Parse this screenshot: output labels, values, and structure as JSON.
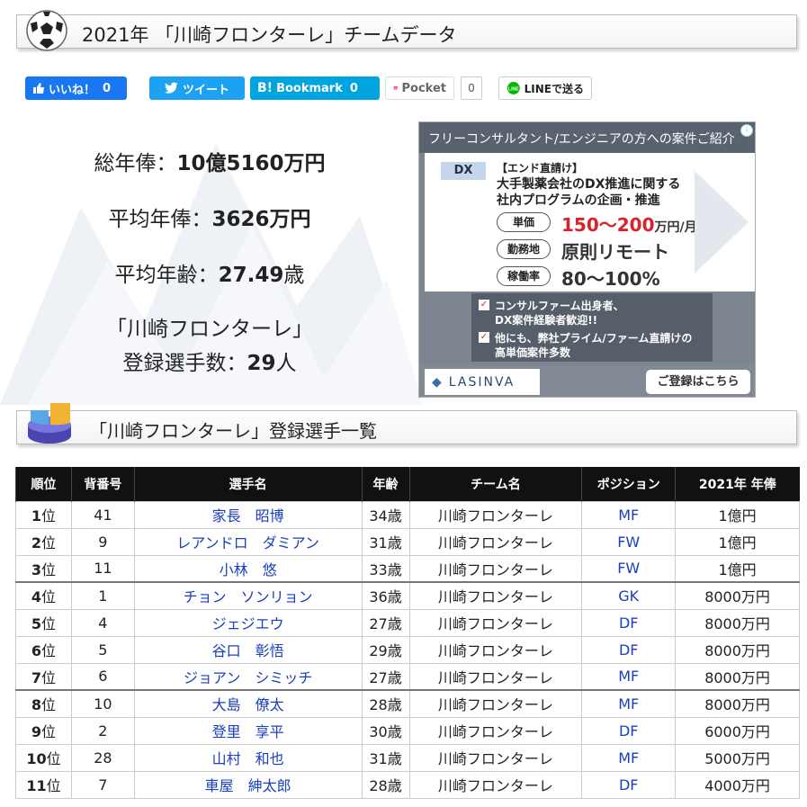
{
  "header": {
    "title": "2021年 「川崎フロンターレ」チームデータ"
  },
  "share": {
    "facebook": {
      "label": "いいね！",
      "count": "0"
    },
    "twitter": {
      "label": "ツイート"
    },
    "hatena": {
      "label": "Bookmark",
      "count": "0"
    },
    "pocket": {
      "label": "Pocket",
      "count": "0"
    },
    "line": {
      "label": "LINEで送る"
    }
  },
  "summary": {
    "total_label": "総年俸：",
    "total_value": "10億5160万円",
    "avg_salary_label": "平均年俸：",
    "avg_salary_value": "3626万円",
    "avg_age_label": "平均年齢：",
    "avg_age_value": "27.49",
    "avg_age_unit": "歳",
    "team_line": "「川崎フロンターレ」",
    "players_label": "登録選手数：",
    "players_value": "29",
    "players_unit": "人"
  },
  "ad": {
    "headline": "フリーコンサルタント/エンジニアの方への案件ご紹介",
    "tag": "DX",
    "line1": "【エンド直請け】",
    "line2": "大手製薬会社のDX推進に関する",
    "line3": "社内プログラムの企画・推進",
    "pill1": "単価",
    "value1": "150～200",
    "value1_unit": "万円/月",
    "pill2": "勤務地",
    "value2": "原則リモート",
    "pill3": "稼働率",
    "value3": "80～100%",
    "check1a": "コンサルファーム出身者、",
    "check1b": "DX案件経験者歓迎!!",
    "check2a": "他にも、弊社プライム/ファーム直請けの",
    "check2b": "高単価案件多数",
    "logo": "LASINVA",
    "cta": "ご登録はこちら"
  },
  "section": {
    "title": "「川崎フロンターレ」登録選手一覧"
  },
  "table": {
    "headers": [
      "順位",
      "背番号",
      "選手名",
      "年齢",
      "チーム名",
      "ポジション",
      "2021年 年俸"
    ],
    "rank_suffix": "位",
    "rows": [
      {
        "rank": "1",
        "number": "41",
        "name": "家長　昭博",
        "age": "34歳",
        "team": "川崎フロンターレ",
        "pos": "MF",
        "salary": "1億円"
      },
      {
        "rank": "2",
        "number": "9",
        "name": "レアンドロ　ダミアン",
        "age": "31歳",
        "team": "川崎フロンターレ",
        "pos": "FW",
        "salary": "1億円"
      },
      {
        "rank": "3",
        "number": "11",
        "name": "小林　悠",
        "age": "33歳",
        "team": "川崎フロンターレ",
        "pos": "FW",
        "salary": "1億円"
      },
      {
        "rank": "4",
        "number": "1",
        "name": "チョン　ソンリョン",
        "age": "36歳",
        "team": "川崎フロンターレ",
        "pos": "GK",
        "salary": "8000万円"
      },
      {
        "rank": "5",
        "number": "4",
        "name": "ジェジエウ",
        "age": "27歳",
        "team": "川崎フロンターレ",
        "pos": "DF",
        "salary": "8000万円"
      },
      {
        "rank": "6",
        "number": "5",
        "name": "谷口　彰悟",
        "age": "29歳",
        "team": "川崎フロンターレ",
        "pos": "DF",
        "salary": "8000万円"
      },
      {
        "rank": "7",
        "number": "6",
        "name": "ジョアン　シミッチ",
        "age": "27歳",
        "team": "川崎フロンターレ",
        "pos": "MF",
        "salary": "8000万円"
      },
      {
        "rank": "8",
        "number": "10",
        "name": "大島　僚太",
        "age": "28歳",
        "team": "川崎フロンターレ",
        "pos": "MF",
        "salary": "8000万円"
      },
      {
        "rank": "9",
        "number": "2",
        "name": "登里　享平",
        "age": "30歳",
        "team": "川崎フロンターレ",
        "pos": "DF",
        "salary": "6000万円"
      },
      {
        "rank": "10",
        "number": "28",
        "name": "山村　和也",
        "age": "31歳",
        "team": "川崎フロンターレ",
        "pos": "MF",
        "salary": "5000万円"
      },
      {
        "rank": "11",
        "number": "7",
        "name": "車屋　紳太郎",
        "age": "28歳",
        "team": "川崎フロンターレ",
        "pos": "DF",
        "salary": "4000万円"
      }
    ]
  }
}
